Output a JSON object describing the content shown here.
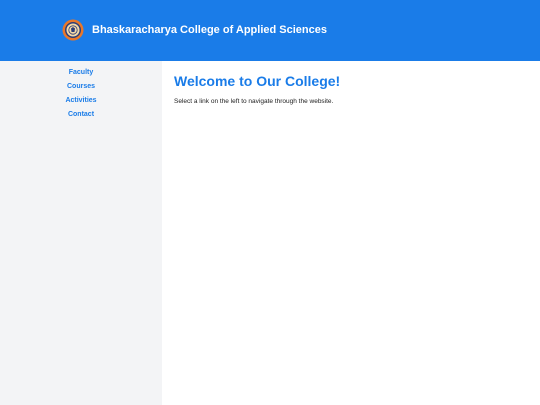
{
  "header": {
    "title": "Bhaskaracharya College of Applied Sciences",
    "logo_icon": "college-seal-icon"
  },
  "sidebar": {
    "items": [
      {
        "label": "Faculty"
      },
      {
        "label": "Courses"
      },
      {
        "label": "Activities"
      },
      {
        "label": "Contact"
      }
    ]
  },
  "main": {
    "title": "Welcome to Our College!",
    "intro": "Select a link on the left to navigate through the website."
  },
  "colors": {
    "brand": "#1a7ce8",
    "sidebar_bg": "#f3f4f6",
    "logo_orange": "#e8772a",
    "logo_navy": "#2c3d78"
  }
}
